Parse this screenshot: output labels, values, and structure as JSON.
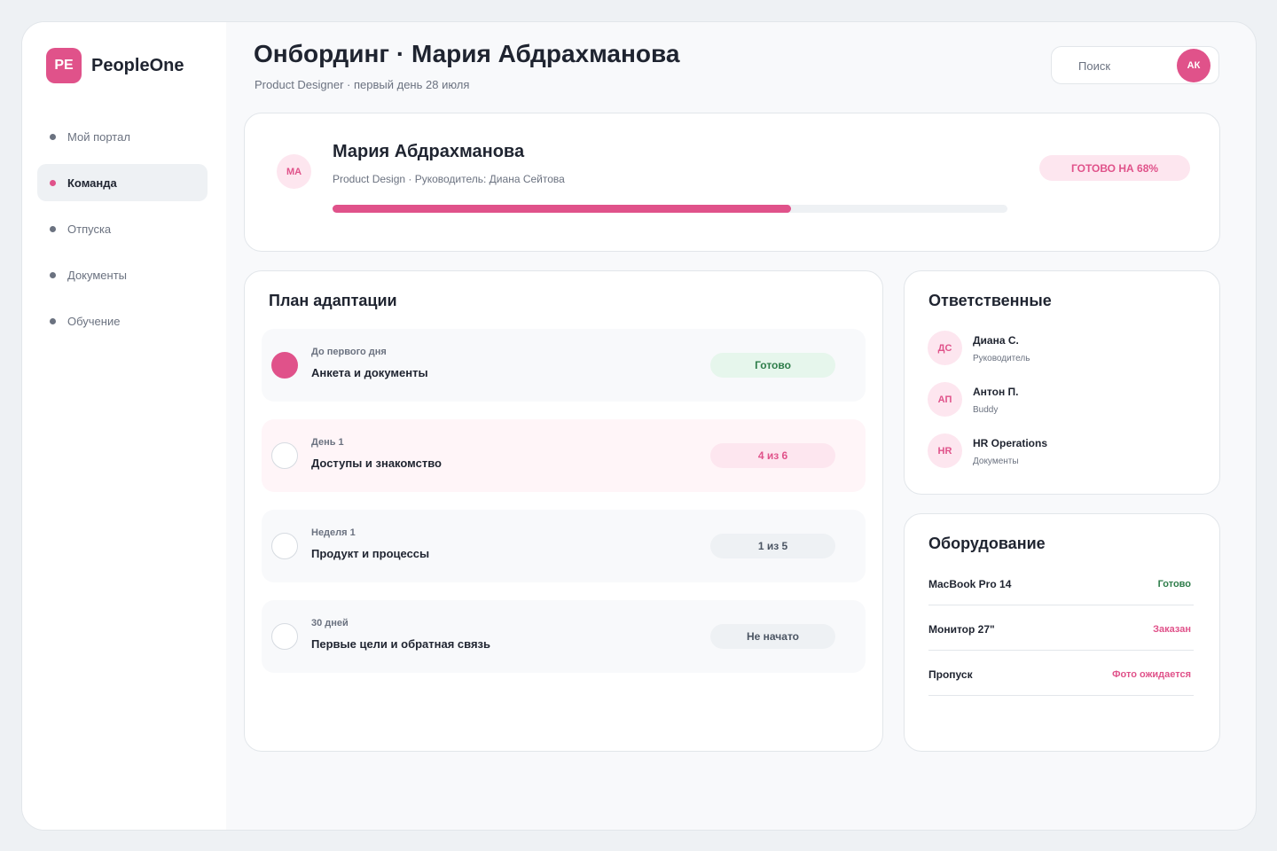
{
  "brand": {
    "mark": "PE",
    "name": "PeopleOne"
  },
  "nav": [
    {
      "label": "Мой портал",
      "active": false
    },
    {
      "label": "Команда",
      "active": true
    },
    {
      "label": "Отпуска",
      "active": false
    },
    {
      "label": "Документы",
      "active": false
    },
    {
      "label": "Обучение",
      "active": false
    }
  ],
  "header": {
    "title": "Онбординг · Мария Абдрахманова",
    "subtitle": "Product Designer · первый день 28 июля"
  },
  "search": {
    "placeholder": "Поиск"
  },
  "user": {
    "initials": "АК"
  },
  "profile": {
    "initials": "МА",
    "name": "Мария Абдрахманова",
    "meta": "Product Design · Руководитель: Диана Сейтова",
    "progress_percent": 68,
    "ready_label": "ГОТОВО НА 68%"
  },
  "plan": {
    "title": "План адаптации",
    "steps": [
      {
        "label": "До первого дня",
        "title": "Анкета и документы",
        "status": "Готово",
        "done": true
      },
      {
        "label": "День 1",
        "title": "Доступы и знакомство",
        "status": "4 из 6",
        "done": false
      },
      {
        "label": "Неделя 1",
        "title": "Продукт и процессы",
        "status": "1 из 5",
        "done": false
      },
      {
        "label": "30 дней",
        "title": "Первые цели и обратная связь",
        "status": "Не начато",
        "done": false
      }
    ]
  },
  "responsibles": {
    "title": "Ответственные",
    "people": [
      {
        "initials": "ДС",
        "name": "Диана С.",
        "role": "Руководитель"
      },
      {
        "initials": "АП",
        "name": "Антон П.",
        "role": "Buddy"
      },
      {
        "initials": "HR",
        "name": "HR Operations",
        "role": "Документы"
      }
    ]
  },
  "equipment": {
    "title": "Оборудование",
    "items": [
      {
        "name": "MacBook Pro 14",
        "status": "Готово",
        "color": "#2e7d4a"
      },
      {
        "name": "Монитор 27\"",
        "status": "Заказан",
        "color": "#e0528a"
      },
      {
        "name": "Пропуск",
        "status": "Фото ожидается",
        "color": "#e0528a"
      }
    ]
  },
  "colors": {
    "accent": "#e0528a",
    "success": "#2e7d4a",
    "muted": "#6b7280"
  }
}
